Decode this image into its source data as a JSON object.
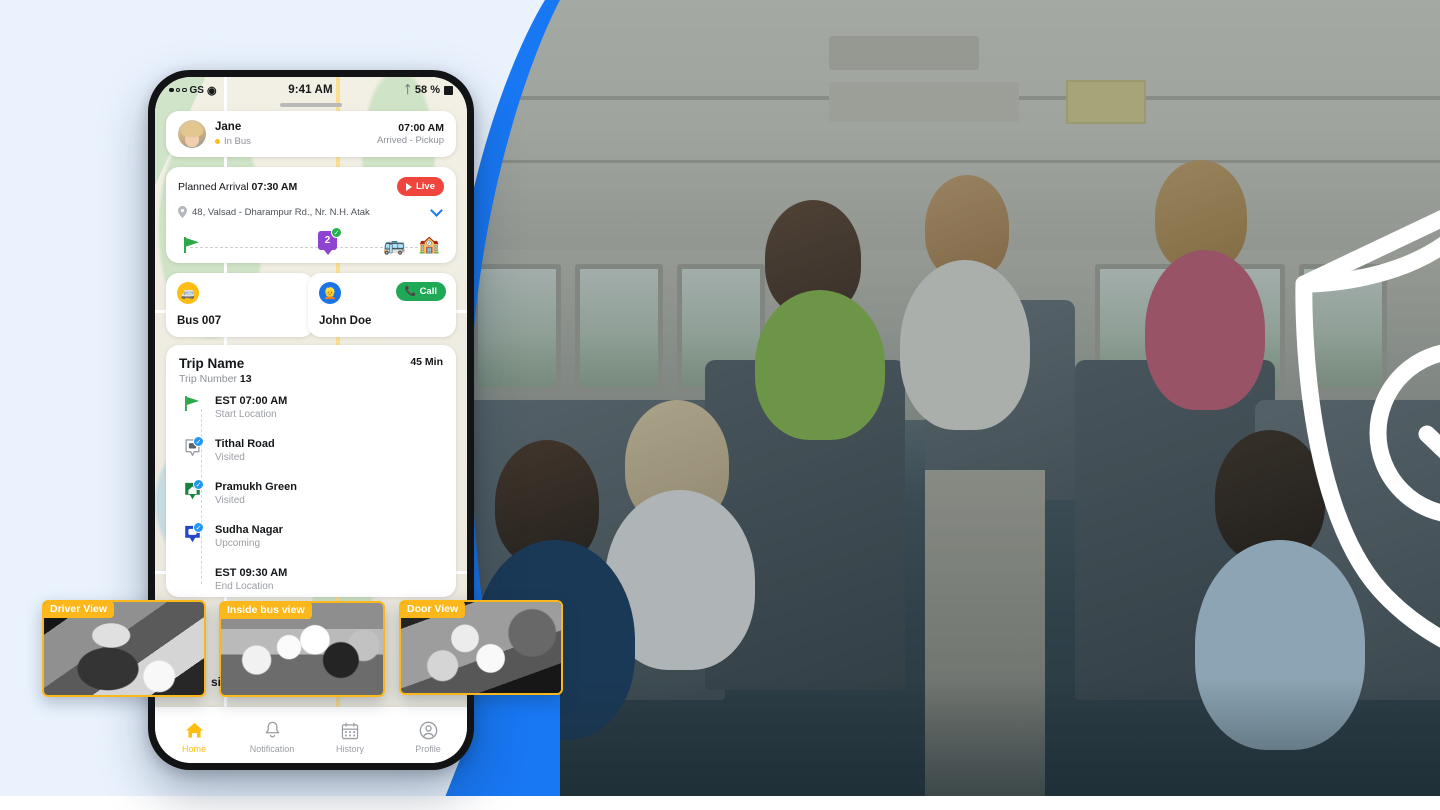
{
  "theme": {
    "page_bg": "#e9f2fd",
    "accent_blue": "#1877f2",
    "accent_yellow": "#febd11",
    "thumb_border": "#fcb81a",
    "live_red": "#f0453c",
    "call_green": "#1fa855"
  },
  "phone": {
    "status_bar": {
      "carrier": "GS",
      "signal_icon": "signal-dots-icon",
      "wifi_icon": "wifi-icon",
      "time": "9:41 AM",
      "bluetooth_icon": "bluetooth-icon",
      "battery_pct": "58 %",
      "battery_icon": "battery-icon"
    },
    "student_card": {
      "avatar": "student-avatar",
      "name": "Jane",
      "status": "In Bus",
      "status_dot_color": "#febd11",
      "time": "07:00 AM",
      "event": "Arrived - Pickup"
    },
    "trip_card": {
      "planned_label": "Planned Arrival",
      "planned_time": "07:30 AM",
      "live_label": "Live",
      "live_icon": "play-icon",
      "location_icon": "map-pin-icon",
      "address": "48, Valsad - Dharampur Rd., Nr. N.H. Atak",
      "expand_icon": "chevron-down-icon",
      "route": {
        "start_icon": "green-flag-icon",
        "stop_badge": "2",
        "stop_check_icon": "check-icon",
        "bus_icon": "bus-icon",
        "school_icon": "school-icon"
      }
    },
    "bus_card": {
      "icon": "bus-circle-icon",
      "title": "Bus 007"
    },
    "driver_card": {
      "icon": "driver-circle-icon",
      "title": "John Doe",
      "call_label": "Call",
      "call_icon": "phone-icon"
    },
    "detail_card": {
      "trip_name": "Trip Name",
      "trip_number_label": "Trip Number",
      "trip_number": "13",
      "duration": "45 Min",
      "stops": [
        {
          "icon": "green-flag-icon",
          "name": "EST 07:00 AM",
          "sub": "Start Location",
          "checked": false
        },
        {
          "icon": "bus-stop-pin-icon",
          "name": "Tithal Road",
          "sub": "Visited",
          "checked": true
        },
        {
          "icon": "home-pin-icon",
          "name": "Pramukh Green",
          "sub": "Visited",
          "checked": true
        },
        {
          "icon": "bus-pin-icon",
          "name": "Sudha Nagar",
          "sub": "Upcoming",
          "checked": true
        },
        {
          "icon": "none",
          "name": "EST 09:30 AM",
          "sub": "End Location",
          "checked": false
        }
      ]
    },
    "section_title_partial": "si",
    "bottom_nav": [
      {
        "icon": "home-icon",
        "label": "Home",
        "active": true
      },
      {
        "icon": "bell-icon",
        "label": "Notification",
        "active": false
      },
      {
        "icon": "calendar-icon",
        "label": "History",
        "active": false
      },
      {
        "icon": "user-circle-icon",
        "label": "Profile",
        "active": false
      }
    ]
  },
  "video_thumbs": [
    {
      "label": "Driver View"
    },
    {
      "label": "Inside bus view"
    },
    {
      "label": "Door View"
    }
  ],
  "hero": {
    "shield_icon": "shield-check-icon",
    "scene": "school-bus-interior-with-children"
  }
}
